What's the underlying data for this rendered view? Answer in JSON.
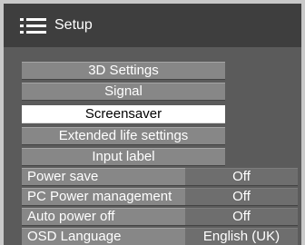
{
  "header": {
    "title": "Setup",
    "icon": "menu-list-icon"
  },
  "menu": {
    "items": [
      {
        "label": "3D Settings"
      },
      {
        "label": "Signal"
      },
      {
        "label": "Screensaver",
        "selected": true
      },
      {
        "label": "Extended life settings"
      },
      {
        "label": "Input label"
      }
    ]
  },
  "settings": [
    {
      "label": "Power save",
      "value": "Off"
    },
    {
      "label": "PC Power management",
      "value": "Off"
    },
    {
      "label": "Auto power off",
      "value": "Off"
    },
    {
      "label": "OSD Language",
      "value": "English (UK)"
    }
  ],
  "colors": {
    "frame": "#c9c9c9",
    "titlebar": "#3e3e3e",
    "item": "#878787",
    "selected": "#ffffff",
    "value": "#6e6e6e"
  }
}
